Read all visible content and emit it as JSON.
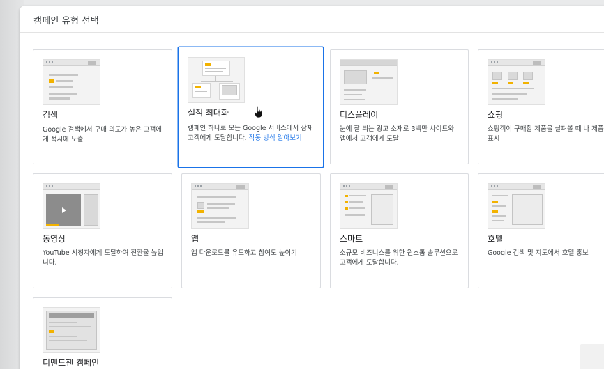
{
  "header": {
    "title": "캠페인 유형 선택"
  },
  "cards": [
    {
      "name": "검색",
      "desc": "Google 검색에서 구매 의도가 높은 고객에게 적시에 노출"
    },
    {
      "name": "실적 최대화",
      "desc": "캠페인 하나로 모든 Google 서비스에서 잠재고객에게 도달합니다. ",
      "link": "작동 방식 알아보기"
    },
    {
      "name": "디스플레이",
      "desc": "눈에 잘 띄는 광고 소재로 3백만 사이트와 앱에서 고객에게 도달"
    },
    {
      "name": "쇼핑",
      "desc": "쇼핑객이 구매할 제품을 살펴볼 때 나 제품 표시"
    },
    {
      "name": "동영상",
      "desc": "YouTube 시청자에게 도달하여 전환율 높입니다."
    },
    {
      "name": "앱",
      "desc": "앱 다운로드를 유도하고 참여도 높이기"
    },
    {
      "name": "스마트",
      "desc": "소규모 비즈니스를 위한 원스톱 솔루션으로 고객에게 도달합니다."
    },
    {
      "name": "호텔",
      "desc": "Google 검색 및 지도에서 호텔 홍보"
    },
    {
      "name": "디맨드젠 캠페인",
      "desc": ""
    }
  ],
  "colors": {
    "accent": "#1a73e8",
    "highlight": "#f2b200",
    "border": "#dadce0"
  },
  "selected_card": "실적 최대화",
  "icons": [
    "hand-pointer-cursor-icon",
    "play-icon"
  ]
}
